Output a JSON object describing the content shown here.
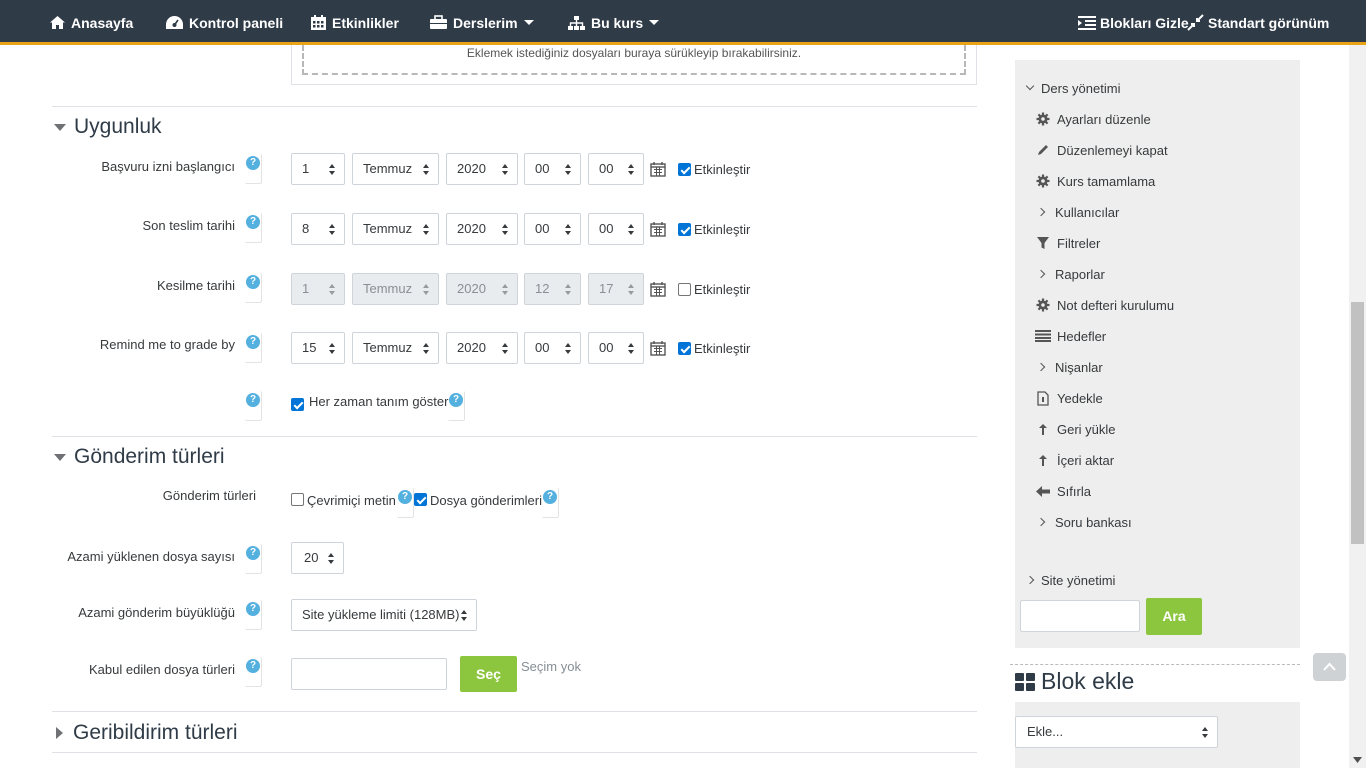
{
  "navbar": {
    "home": "Anasayfa",
    "dashboard": "Kontrol paneli",
    "events": "Etkinlikler",
    "my_courses": "Derslerim",
    "this_course": "Bu kurs",
    "hide_blocks": "Blokları Gizle",
    "standard_view": "Standart görünüm"
  },
  "form": {
    "dropzone_text": "Eklemek istediğiniz dosyaları buraya sürükleyip bırakabilirsiniz.",
    "availability": {
      "title": "Uygunluk",
      "rows": [
        {
          "label": "Başvuru izni başlangıcı",
          "day": "1",
          "month": "Temmuz",
          "year": "2020",
          "hour": "00",
          "minute": "00",
          "enable_label": "Etkinleştir",
          "enabled": true
        },
        {
          "label": "Son teslim tarihi",
          "day": "8",
          "month": "Temmuz",
          "year": "2020",
          "hour": "00",
          "minute": "00",
          "enable_label": "Etkinleştir",
          "enabled": true
        },
        {
          "label": "Kesilme tarihi",
          "day": "1",
          "month": "Temmuz",
          "year": "2020",
          "hour": "12",
          "minute": "17",
          "enable_label": "Etkinleştir",
          "enabled": false
        },
        {
          "label": "Remind me to grade by",
          "day": "15",
          "month": "Temmuz",
          "year": "2020",
          "hour": "00",
          "minute": "00",
          "enable_label": "Etkinleştir",
          "enabled": true
        }
      ],
      "always_show_label": "Her zaman tanım göster"
    },
    "submission_types": {
      "title": "Gönderim türleri",
      "types_label": "Gönderim türleri",
      "online_text": "Çevrimiçi metin",
      "file_submissions": "Dosya gönderimleri",
      "max_files_label": "Azami yüklenen dosya sayısı",
      "max_files_value": "20",
      "max_size_label": "Azami gönderim büyüklüğü",
      "max_size_value": "Site yükleme limiti (128MB)",
      "accepted_types_label": "Kabul edilen dosya türleri",
      "choose_button": "Seç",
      "no_selection": "Seçim yok"
    },
    "feedback_types": {
      "title": "Geribildirim türleri"
    }
  },
  "sidebar": {
    "course_admin": "Ders yönetimi",
    "items": [
      {
        "label": "Ayarları düzenle",
        "icon": "gear-icon"
      },
      {
        "label": "Düzenlemeyi kapat",
        "icon": "pencil-icon"
      },
      {
        "label": "Kurs tamamlama",
        "icon": "gear-icon"
      },
      {
        "label": "Kullanıcılar",
        "icon": "chevron-right-icon"
      },
      {
        "label": "Filtreler",
        "icon": "filter-icon"
      },
      {
        "label": "Raporlar",
        "icon": "chevron-right-icon"
      },
      {
        "label": "Not defteri kurulumu",
        "icon": "gear-icon"
      },
      {
        "label": "Hedefler",
        "icon": "list-icon"
      },
      {
        "label": "Nişanlar",
        "icon": "chevron-right-icon"
      },
      {
        "label": "Yedekle",
        "icon": "file-icon"
      },
      {
        "label": "Geri yükle",
        "icon": "upload-icon"
      },
      {
        "label": "İçeri aktar",
        "icon": "upload-icon"
      },
      {
        "label": "Sıfırla",
        "icon": "arrow-left-icon"
      },
      {
        "label": "Soru bankası",
        "icon": "chevron-right-icon"
      }
    ],
    "site_admin": "Site yönetimi",
    "search_button": "Ara",
    "add_block_title": "Blok ekle",
    "add_block_select": "Ekle..."
  },
  "colors": {
    "navbar": "#2f3b47",
    "navbar_accent": "#e8a317",
    "green": "#8cc63f",
    "help": "#53b0df",
    "checkbox": "#0075d7"
  }
}
